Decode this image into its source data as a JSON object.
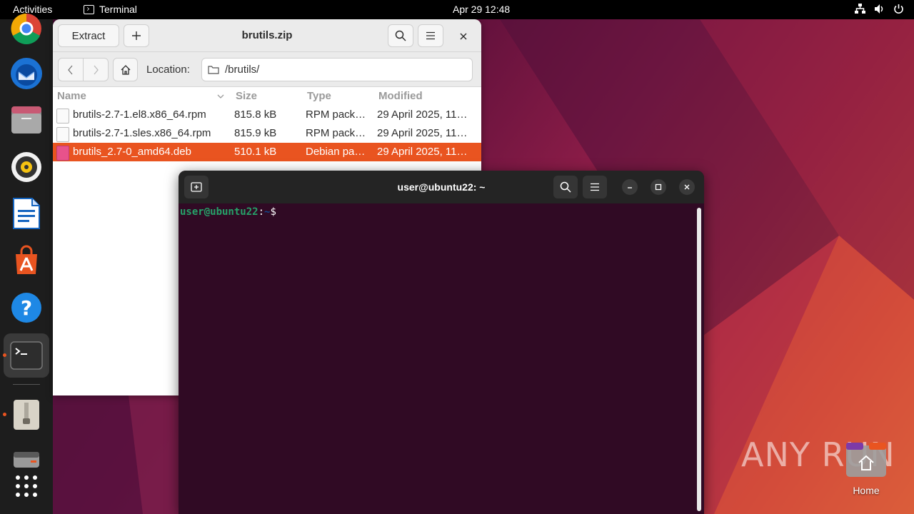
{
  "topbar": {
    "activities": "Activities",
    "app_name": "Terminal",
    "clock": "Apr 29  12:48"
  },
  "dock": {
    "items": [
      "chrome-icon",
      "thunderbird-icon",
      "files-icon",
      "rhythmbox-icon",
      "writer-icon",
      "app-center-icon",
      "help-icon",
      "terminal-icon",
      "archive-manager-icon",
      "disk-icon",
      "show-apps-icon"
    ]
  },
  "archive": {
    "extract_label": "Extract",
    "title": "brutils.zip",
    "location_label": "Location:",
    "location_value": "/brutils/",
    "columns": {
      "name": "Name",
      "size": "Size",
      "type": "Type",
      "modified": "Modified"
    },
    "rows": [
      {
        "name": "brutils-2.7-1.el8.x86_64.rpm",
        "size": "815.8 kB",
        "type": "RPM pack…",
        "modified": "29 April 2025, 11…"
      },
      {
        "name": "brutils-2.7-1.sles.x86_64.rpm",
        "size": "815.9 kB",
        "type": "RPM pack…",
        "modified": "29 April 2025, 11…"
      },
      {
        "name": "brutils_2.7-0_amd64.deb",
        "size": "510.1 kB",
        "type": "Debian pa…",
        "modified": "29 April 2025, 11…"
      }
    ],
    "selected_color": "#e95420"
  },
  "terminal": {
    "title": "user@ubuntu22: ~",
    "prompt_user": "user@ubuntu22",
    "prompt_sep": ":",
    "prompt_path": "~",
    "prompt_dollar": "$",
    "background": "#300a24"
  },
  "desktop": {
    "home_label": "Home",
    "watermark": "ANY RUN"
  }
}
